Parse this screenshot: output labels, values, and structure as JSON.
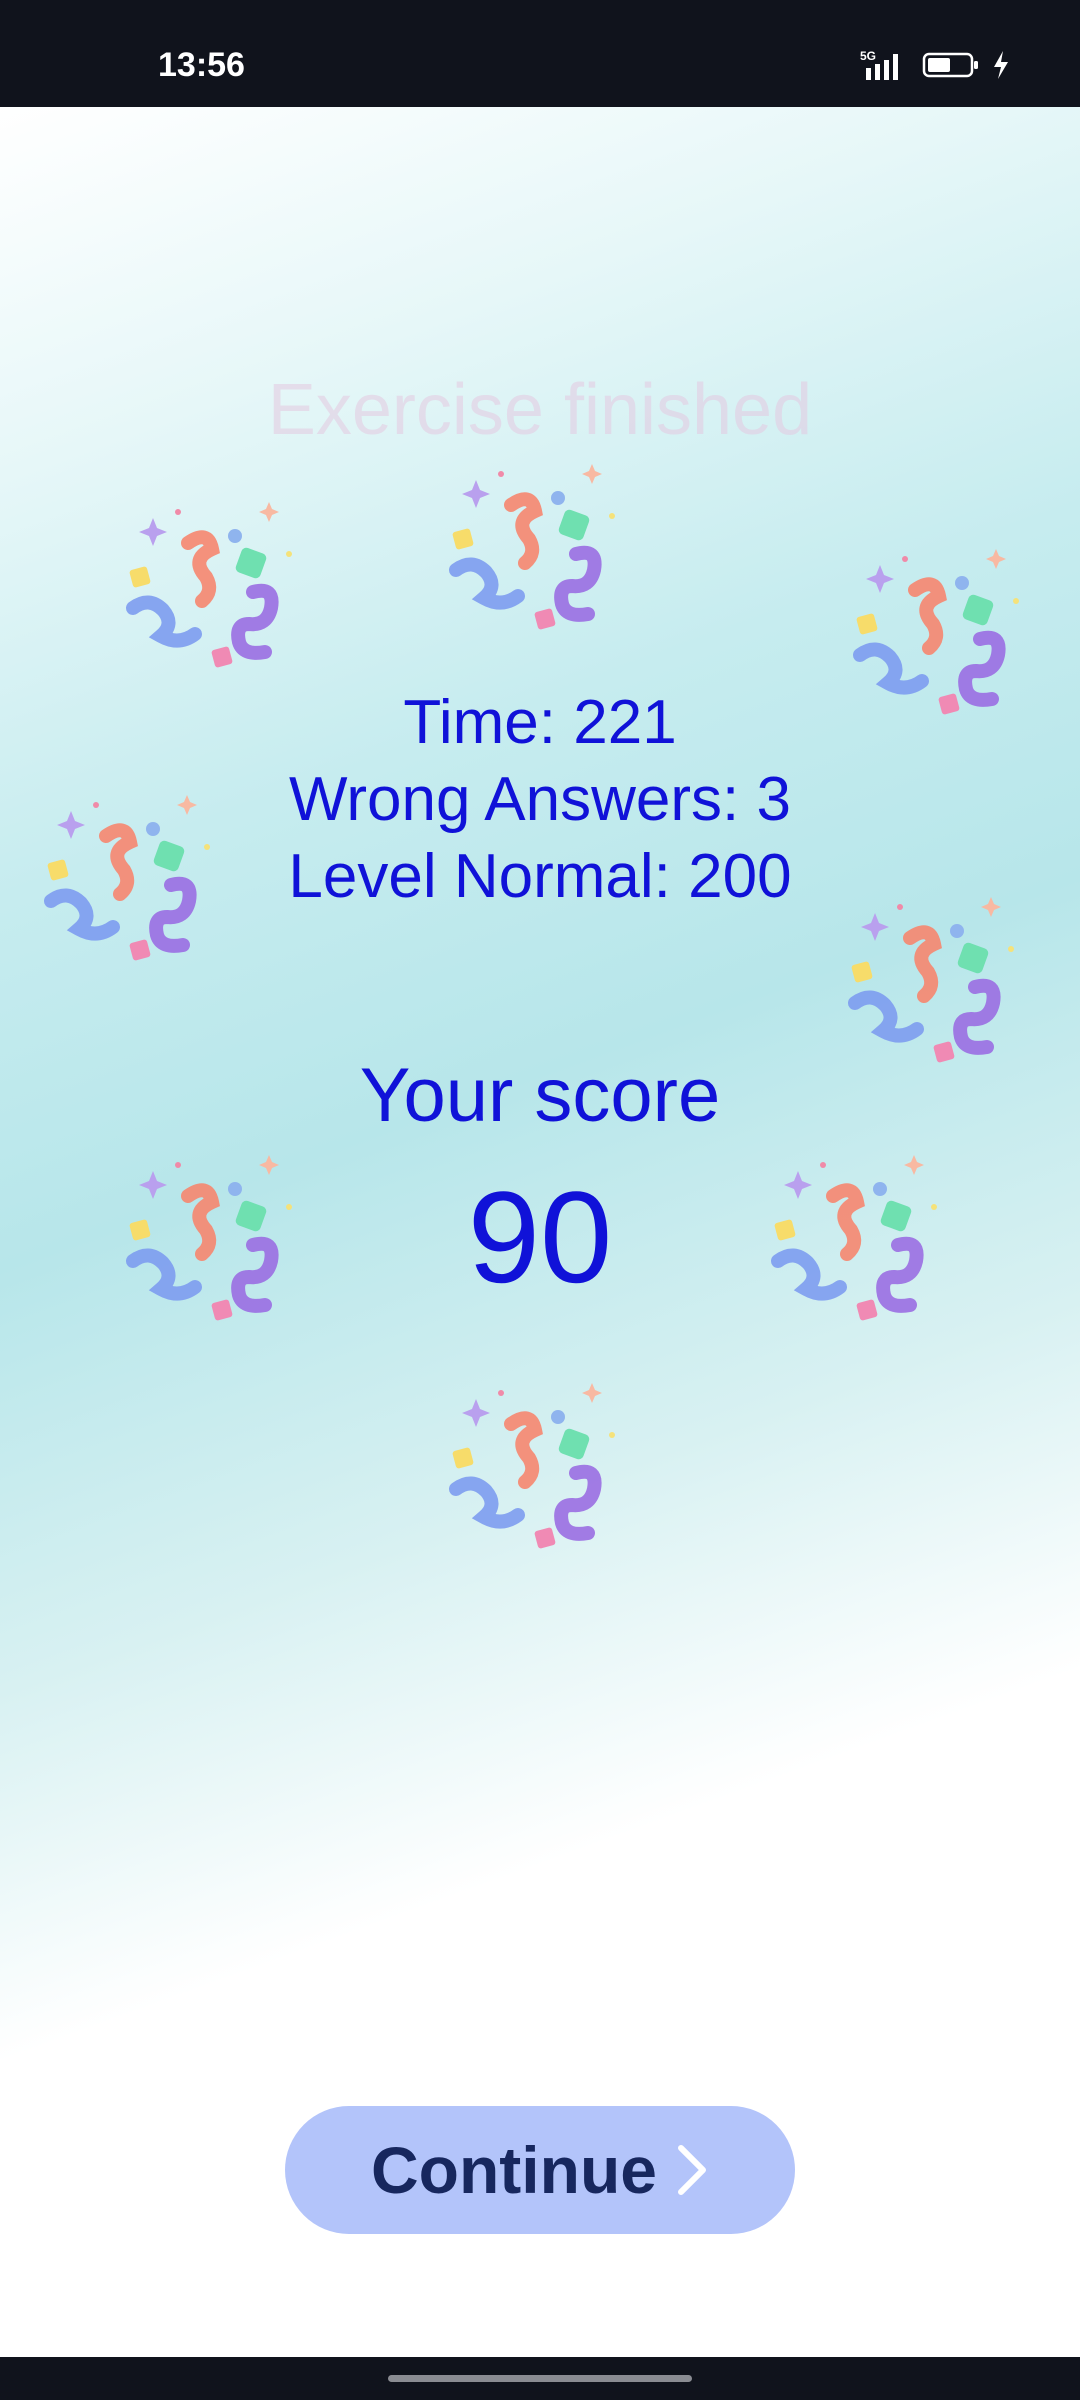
{
  "status_bar": {
    "time": "13:56",
    "network": "5G"
  },
  "page": {
    "title": "Exercise finished"
  },
  "stats": {
    "time_text": "Time: 221",
    "wrong_answers_text": "Wrong Answers: 3",
    "level_text": "Level Normal: 200"
  },
  "score": {
    "label": "Your score",
    "value": "90"
  },
  "actions": {
    "continue_label": "Continue"
  },
  "icons": {
    "confetti": "party-popper-confetti-icon",
    "continue": "chevron-right-icon"
  },
  "colors": {
    "stat_text": "#1012d8",
    "button_bg": "#b3c4fa",
    "button_text": "#17275e",
    "title_text": "#e4c8e0"
  }
}
